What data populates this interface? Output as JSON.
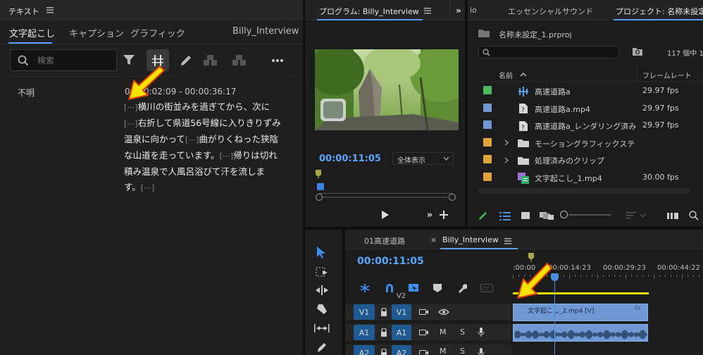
{
  "text_panel": {
    "title": "テキスト",
    "tabs": [
      "文字起こし",
      "キャプション",
      "グラフィック"
    ],
    "sequence_name": "Billy_Interview",
    "search_placeholder": "検索",
    "speaker": "不明",
    "timestamp": "00:00:02:09 - 00:00:36:17",
    "lines": [
      [
        {
          "t": "[⋯]",
          "d": true
        },
        {
          "t": "横川の街並みを過ぎてから、次に",
          "d": false
        }
      ],
      [
        {
          "t": "[⋯]",
          "d": true
        },
        {
          "t": "右折して県道56号線に入りきりずみ",
          "d": false
        }
      ],
      [
        {
          "t": "温泉に向かって",
          "d": false
        },
        {
          "t": "[⋯]",
          "d": true
        },
        {
          "t": "曲がりくねった狭陰",
          "d": false
        }
      ],
      [
        {
          "t": "な山道を走っています。",
          "d": false
        },
        {
          "t": "[⋯]",
          "d": true
        },
        {
          "t": "帰りは切れ",
          "d": false
        }
      ],
      [
        {
          "t": "積み温泉で人風呂浴びて汗を流しま",
          "d": false
        }
      ],
      [
        {
          "t": "す。",
          "d": false
        },
        {
          "t": "[⋯]",
          "d": true
        }
      ]
    ]
  },
  "program_monitor": {
    "title": "プログラム: Billy_Interview",
    "timecode": "00:00:11:05",
    "zoom": "全体表示"
  },
  "project_panel": {
    "tabs": [
      "io",
      "エッセンシャルサウンド",
      "プロジェクト: 名称未設定"
    ],
    "project_file": "名称未設定_1.prproj",
    "item_count": "117 個中 1",
    "col_name": "名前",
    "col_fps": "フレームレート",
    "items": [
      {
        "name": "高速道路a",
        "fps": "29.97 fps",
        "color": "#4db85d",
        "icon": "sequence",
        "folder": false
      },
      {
        "name": "高速道路a.mp4",
        "fps": "29.97 fps",
        "color": "#6f98d4",
        "icon": "missing-file",
        "folder": false
      },
      {
        "name": "高速道路a_レンダリング済み",
        "fps": "29.97 fps",
        "color": "#6f98d4",
        "icon": "missing-file",
        "folder": false
      },
      {
        "name": "モーショングラフィックステ",
        "fps": "",
        "color": "#e3a33c",
        "icon": "folder",
        "folder": true
      },
      {
        "name": "処理済みのクリップ",
        "fps": "",
        "color": "#e3a33c",
        "icon": "folder",
        "folder": true
      },
      {
        "name": "文字起こし_1.mp4",
        "fps": "30.00 fps",
        "color": "#e3a33c",
        "icon": "media",
        "folder": false
      }
    ]
  },
  "timeline": {
    "tabs": [
      "01高速道路",
      "Billy_Interview"
    ],
    "timecode": "00:00:11:05",
    "ruler": [
      ":00:00",
      "00:00:14:23",
      "00:00:29:23",
      "00:00:44:22"
    ],
    "tracks": [
      {
        "id": "V2",
        "target": ""
      },
      {
        "id": "V1",
        "target": "V1"
      },
      {
        "id": "A1",
        "target": "A1"
      },
      {
        "id": "A2",
        "target": "A2"
      }
    ],
    "clip_name": "文字起こし_2.mp4 [V]",
    "clip_fx": "fx",
    "m": "M",
    "s": "S"
  }
}
